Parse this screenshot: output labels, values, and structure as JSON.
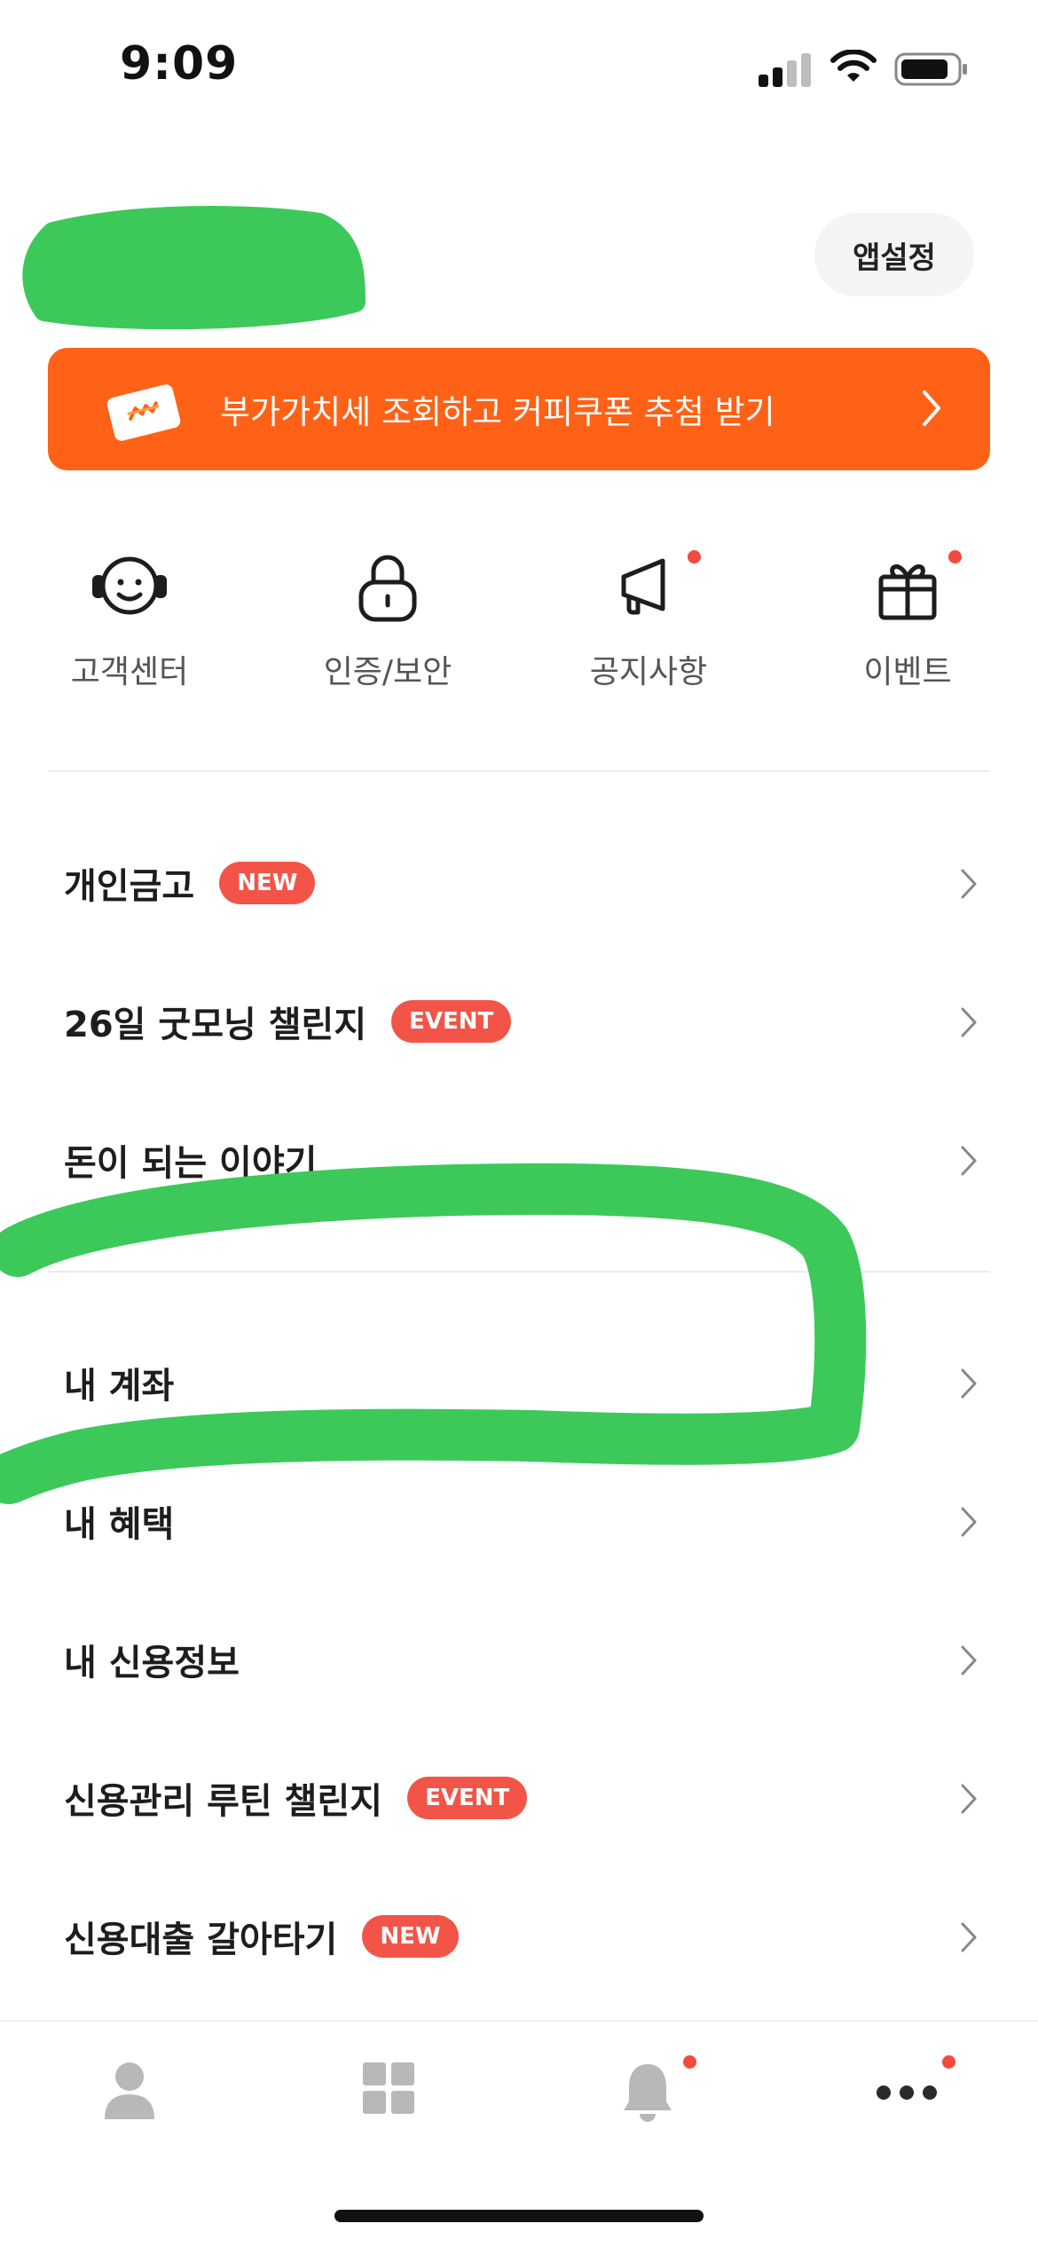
{
  "status_bar": {
    "time": "9:09"
  },
  "header": {
    "app_settings_label": "앱설정"
  },
  "promo_banner": {
    "text": "부가가치세 조회하고 커피쿠폰 추첨 받기",
    "icon": "coupon-ticket-icon",
    "color": "#ff6116"
  },
  "quick_menu": [
    {
      "label": "고객센터",
      "icon": "headset-face-icon",
      "has_dot": false
    },
    {
      "label": "인증/보안",
      "icon": "lock-icon",
      "has_dot": false
    },
    {
      "label": "공지사항",
      "icon": "megaphone-icon",
      "has_dot": true
    },
    {
      "label": "이벤트",
      "icon": "gift-icon",
      "has_dot": true
    }
  ],
  "menu_group_1": [
    {
      "label": "개인금고",
      "badge": "NEW"
    },
    {
      "label": "26일 굿모닝 챌린지",
      "badge": "EVENT"
    },
    {
      "label": "돈이 되는 이야기",
      "badge": ""
    }
  ],
  "menu_group_2": [
    {
      "label": "내 계좌",
      "badge": ""
    },
    {
      "label": "내 혜택",
      "badge": ""
    },
    {
      "label": "내 신용정보",
      "badge": ""
    },
    {
      "label": "신용관리 루틴 챌린지",
      "badge": "EVENT"
    },
    {
      "label": "신용대출 갈아타기",
      "badge": "NEW"
    }
  ],
  "tab_bar": [
    {
      "icon": "person-icon",
      "has_dot": false
    },
    {
      "icon": "grid-icon",
      "has_dot": false
    },
    {
      "icon": "bell-icon",
      "has_dot": true
    },
    {
      "icon": "more-dots-icon",
      "has_dot": true
    }
  ],
  "colors": {
    "accent": "#ff6116",
    "badge": "#f25548",
    "notification_dot": "#f04b3e",
    "redaction_marker": "#3cc95a"
  }
}
